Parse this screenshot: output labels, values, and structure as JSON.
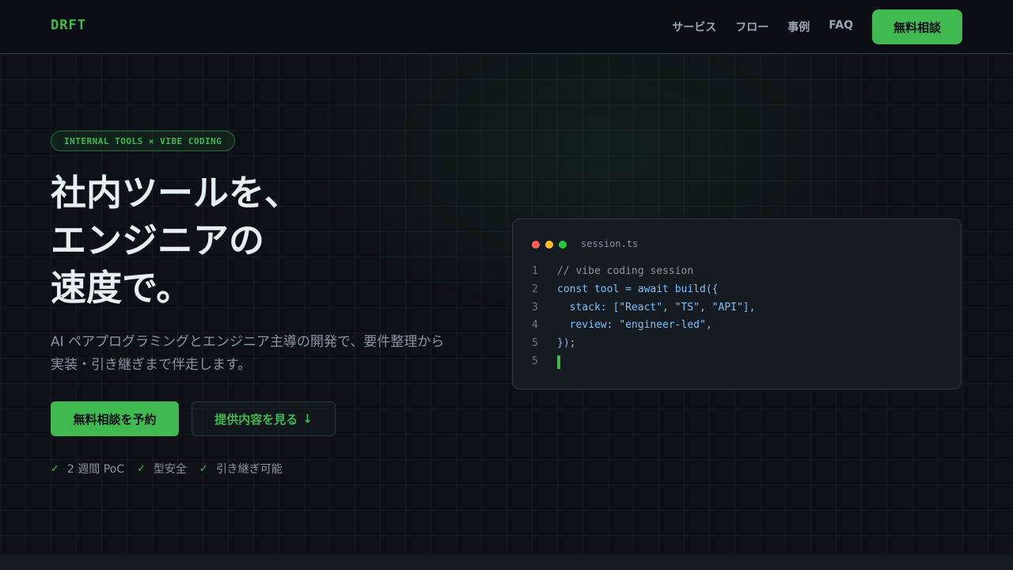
{
  "header": {
    "logo": "DRFT",
    "nav": [
      "サービス",
      "フロー",
      "事例",
      "FAQ"
    ],
    "cta_label": "無料相談"
  },
  "hero": {
    "badge": "INTERNAL TOOLS × VIBE CODING",
    "headline_lines": [
      "社内ツールを、",
      "エンジニアの",
      "速度で。"
    ],
    "subtext_lines": [
      "AI ペアプログラミングとエンジニア主導の開発で、要件整理から",
      "実装・引き継ぎまで伴走します。"
    ],
    "primary_button": "無料相談を予約",
    "secondary_button": "提供内容を見る",
    "secondary_button_arrow": "↓",
    "checks": [
      "2 週間 PoC",
      "型安全",
      "引き継ぎ可能"
    ],
    "check_mark": "✓"
  },
  "code_window": {
    "filename": "session.ts",
    "lines": [
      {
        "n": "1",
        "text": "// vibe coding session",
        "kind": "comment"
      },
      {
        "n": "2",
        "text": "const tool = await build({",
        "kind": "code"
      },
      {
        "n": "3",
        "text": "  stack: [\"React\", \"TS\", \"API\"],",
        "kind": "code"
      },
      {
        "n": "4",
        "text": "  review: \"engineer-led\",",
        "kind": "code"
      },
      {
        "n": "5",
        "text": "});",
        "kind": "code"
      },
      {
        "n": "5",
        "text": "",
        "kind": "cursor"
      }
    ],
    "dot_colors": [
      "#ff5f57",
      "#febc2e",
      "#28c840"
    ]
  },
  "colors": {
    "accent": "#3fb950",
    "background": "#0d1117"
  }
}
